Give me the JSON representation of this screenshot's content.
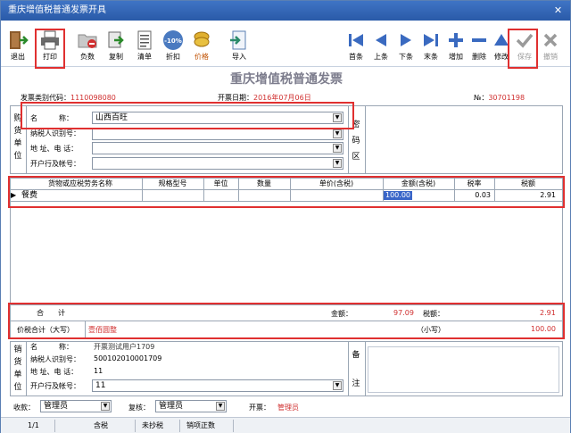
{
  "window": {
    "title": "重庆增值税普通发票开具",
    "close": "✕"
  },
  "toolbar": {
    "exit": "退出",
    "print": "打印",
    "blank": "负数",
    "copy": "复制",
    "list": "清单",
    "discount": "折扣",
    "discount_badge": "-10%",
    "price": "价格",
    "import": "导入",
    "first": "首条",
    "prev": "上条",
    "next": "下条",
    "last": "末条",
    "add": "增加",
    "delete": "删除",
    "edit": "修改",
    "save": "保存",
    "cancel": "撤销"
  },
  "invoice": {
    "title": "重庆增值税普通发票",
    "code_label": "发票类别代码：",
    "code_value": "1110098080",
    "date_label": "开票日期：",
    "date_value": "2016年07月06日",
    "no_label": "№：",
    "no_value": "30701198"
  },
  "buyer": {
    "side_label": [
      "购",
      "货",
      "单",
      "位"
    ],
    "name_label": "名　　　称：",
    "name_value": "山西百旺",
    "tax_label": "纳税人识别号：",
    "tax_value": "",
    "addr_label": "地  址、电  话：",
    "addr_value": "",
    "bank_label": "开户行及帐号：",
    "bank_value": ""
  },
  "cipher": {
    "label": [
      "密",
      "码",
      "区"
    ]
  },
  "items": {
    "headers": [
      "货物或应税劳务名称",
      "规格型号",
      "单位",
      "数量",
      "单价(含税)",
      "金额(含税)",
      "税率",
      "税额"
    ],
    "rows": [
      {
        "name": "餐费",
        "spec": "",
        "unit": "",
        "qty": "",
        "price": "",
        "amount": "100.00",
        "rate": "0.03",
        "tax": "2.91"
      }
    ]
  },
  "totals": {
    "total_label": "合　　计",
    "amount_label": "金额：",
    "amount_value": "97.09",
    "tax_label": "税额：",
    "tax_value": "2.91",
    "caps_label": "价税合计（大写）",
    "caps_value": "壹佰圆整",
    "small_label": "（小写）",
    "small_value": "100.00"
  },
  "seller": {
    "side_label": [
      "销",
      "货",
      "单",
      "位"
    ],
    "name_label": "名　　　称：",
    "name_value": "开票测试用户1709",
    "tax_label": "纳税人识别号：",
    "tax_value": "500102010001709",
    "addr_label": "地  址、电  话：",
    "addr_value": "11",
    "bank_label": "开户行及帐号：",
    "bank_value": "11"
  },
  "remarks": {
    "label": [
      "备",
      "注"
    ]
  },
  "footer": {
    "payee_label": "收款：",
    "payee_value": "管理员",
    "reviewer_label": "复核：",
    "reviewer_value": "管理员",
    "drawer_label": "开票：",
    "drawer_value": "管理员"
  },
  "status": {
    "page": "1/1",
    "tax_type": "含税",
    "copy_status": "未抄税",
    "sale_type": "销项正数"
  }
}
